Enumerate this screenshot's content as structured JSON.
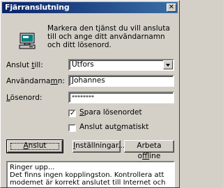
{
  "window": {
    "title": "Fjärranslutning"
  },
  "intro_text": "Markera den tjänst du vill ansluta till och ange ditt användarnamn och ditt lösenord.",
  "form": {
    "connect_to_label_pre": "Anslut ",
    "connect_to_label_key": "t",
    "connect_to_label_post": "ill:",
    "connect_to_value": "Utfors",
    "username_label_pre": "Användarna",
    "username_label_key": "m",
    "username_label_post": "n:",
    "username_value": "Johannes",
    "password_label_pre": "",
    "password_label_key": "L",
    "password_label_post": "ösenord:",
    "password_value": "********"
  },
  "options": {
    "save_password_pre": "",
    "save_password_key": "S",
    "save_password_post": "para lösenordet",
    "save_password_checked": "✓",
    "auto_connect_pre": "Anslut aut",
    "auto_connect_key": "o",
    "auto_connect_post": "matiskt"
  },
  "buttons": {
    "connect_pre": "",
    "connect_key": "A",
    "connect_post": "nslut",
    "settings_pre": "",
    "settings_key": "I",
    "settings_post": "nställningar...",
    "offline_pre": "Arbeta o",
    "offline_key": "f",
    "offline_post": "fline"
  },
  "status": {
    "line1": "Ringer upp...",
    "line2": "Det finns ingen kopplingston. Kontrollera att modemet är korrekt anslutet till Internet och"
  },
  "icons": {
    "close": "close-icon",
    "computer": "computer-icon"
  }
}
